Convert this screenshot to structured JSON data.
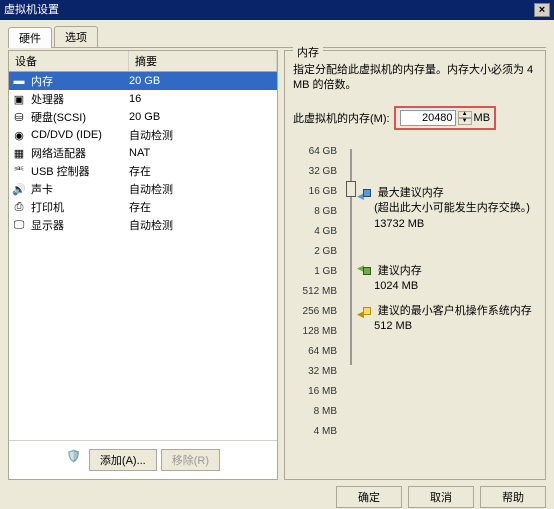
{
  "title": "虚拟机设置",
  "tabs": {
    "hardware": "硬件",
    "options": "选项"
  },
  "list_header": {
    "device": "设备",
    "summary": "摘要"
  },
  "devices": [
    {
      "name": "内存",
      "summary": "20 GB"
    },
    {
      "name": "处理器",
      "summary": "16"
    },
    {
      "name": "硬盘(SCSI)",
      "summary": "20 GB"
    },
    {
      "name": "CD/DVD (IDE)",
      "summary": "自动检测"
    },
    {
      "name": "网络适配器",
      "summary": "NAT"
    },
    {
      "name": "USB 控制器",
      "summary": "存在"
    },
    {
      "name": "声卡",
      "summary": "自动检测"
    },
    {
      "name": "打印机",
      "summary": "存在"
    },
    {
      "name": "显示器",
      "summary": "自动检测"
    }
  ],
  "left_buttons": {
    "add": "添加(A)...",
    "remove": "移除(R)"
  },
  "memory_group": {
    "title": "内存",
    "desc": "指定分配给此虚拟机的内存量。内存大小必须为 4 MB 的倍数。",
    "label": "此虚拟机的内存(M):",
    "value": "20480",
    "unit": "MB",
    "ticks": [
      "64 GB",
      "32 GB",
      "16 GB",
      "8 GB",
      "4 GB",
      "2 GB",
      "1 GB",
      "512 MB",
      "256 MB",
      "128 MB",
      "64 MB",
      "32 MB",
      "16 MB",
      "8 MB",
      "4 MB"
    ],
    "max_rec": {
      "title": "最大建议内存",
      "note": "(超出此大小可能发生内存交换。)",
      "value": "13732 MB"
    },
    "rec": {
      "title": "建议内存",
      "value": "1024 MB"
    },
    "min_rec": {
      "title": "建议的最小客户机操作系统内存",
      "value": "512 MB"
    }
  },
  "dialog": {
    "ok": "确定",
    "cancel": "取消",
    "help": "帮助"
  }
}
